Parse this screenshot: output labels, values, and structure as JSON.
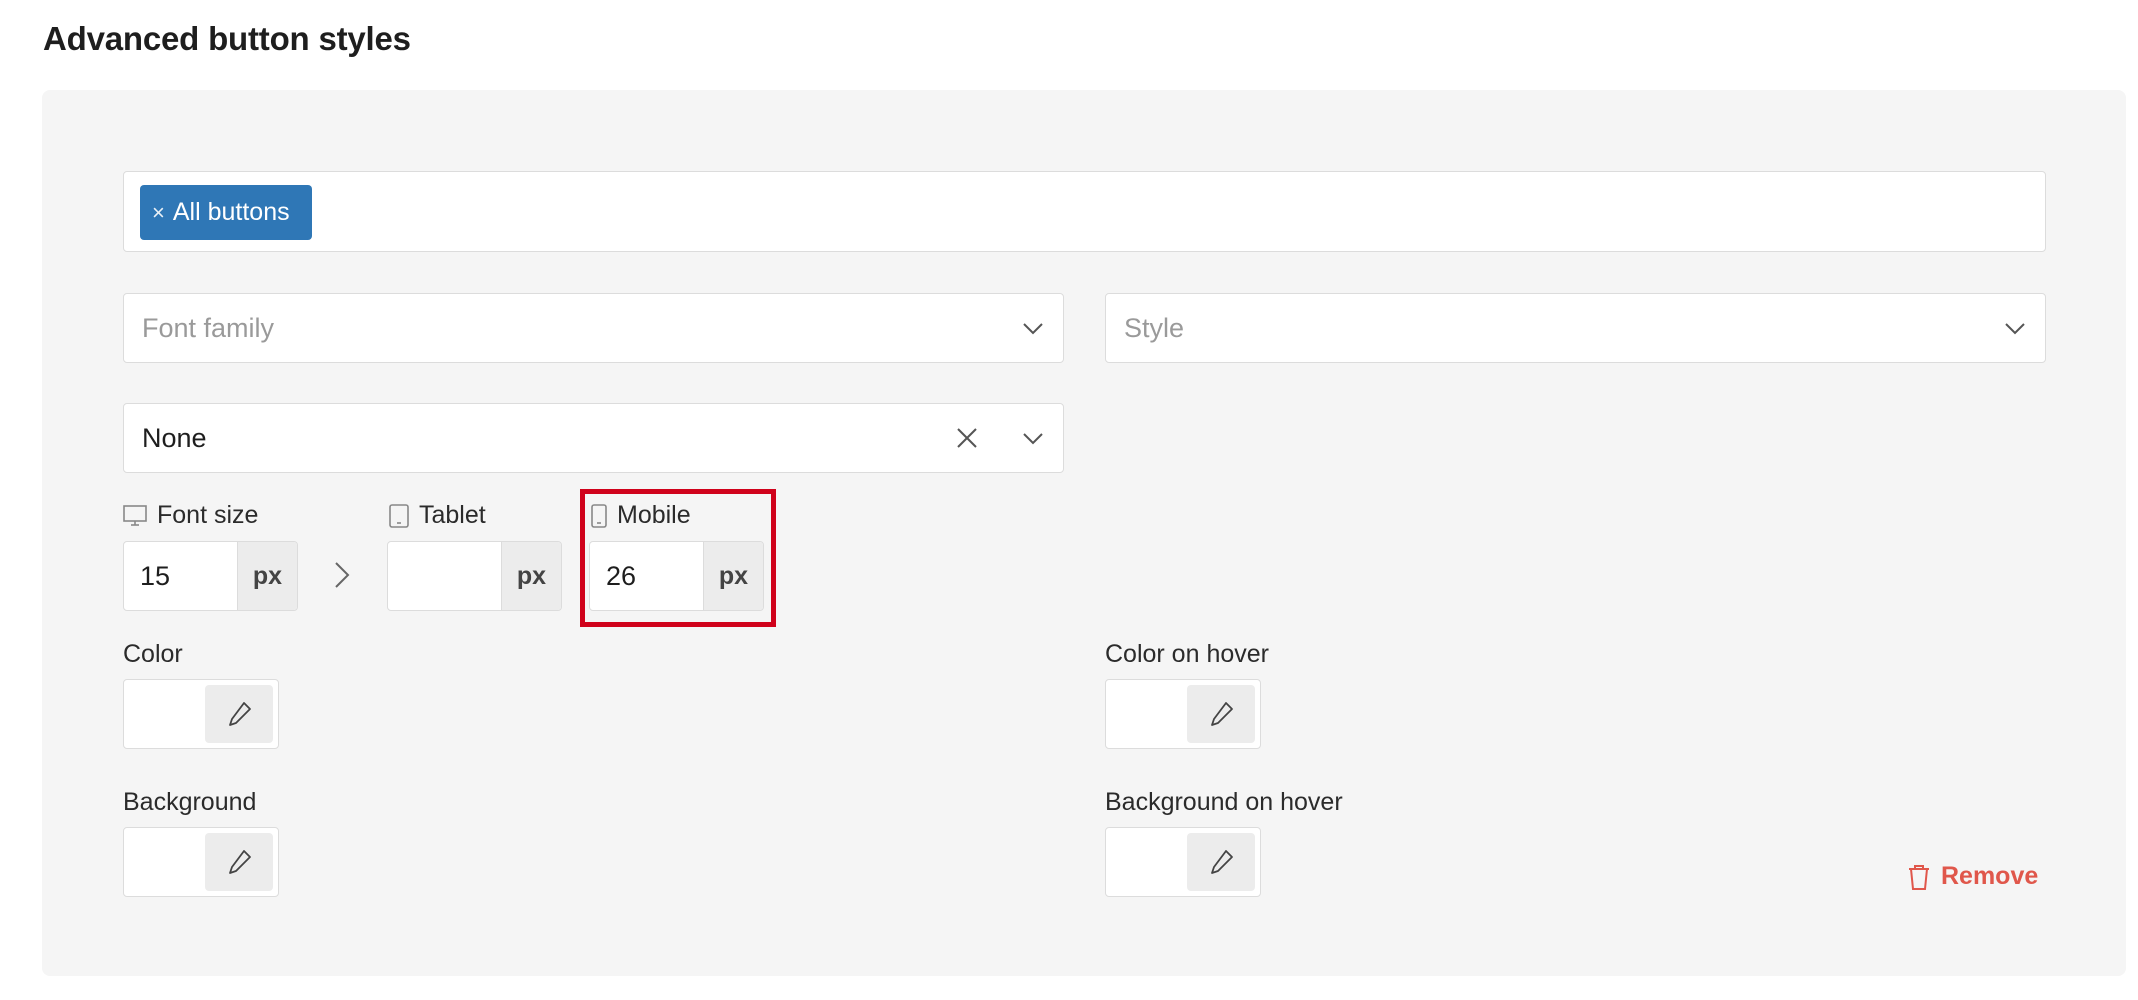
{
  "title": "Advanced button styles",
  "selectors": {
    "tags": [
      {
        "label": "All buttons"
      }
    ]
  },
  "font_family": {
    "placeholder": "Font family"
  },
  "style": {
    "placeholder": "Style"
  },
  "text_transform": {
    "value": "None"
  },
  "font_size": {
    "desktop": {
      "label": "Font size",
      "value": "15",
      "unit": "px"
    },
    "tablet": {
      "label": "Tablet",
      "value": "",
      "unit": "px"
    },
    "mobile": {
      "label": "Mobile",
      "value": "26",
      "unit": "px"
    }
  },
  "colors": {
    "color": {
      "label": "Color"
    },
    "color_hover": {
      "label": "Color on hover"
    },
    "background": {
      "label": "Background"
    },
    "background_hover": {
      "label": "Background on hover"
    }
  },
  "actions": {
    "remove_label": "Remove"
  },
  "accents": {
    "tag_bg": "#2f77b6",
    "highlight": "#d0021b",
    "remove": "#e0574b"
  }
}
